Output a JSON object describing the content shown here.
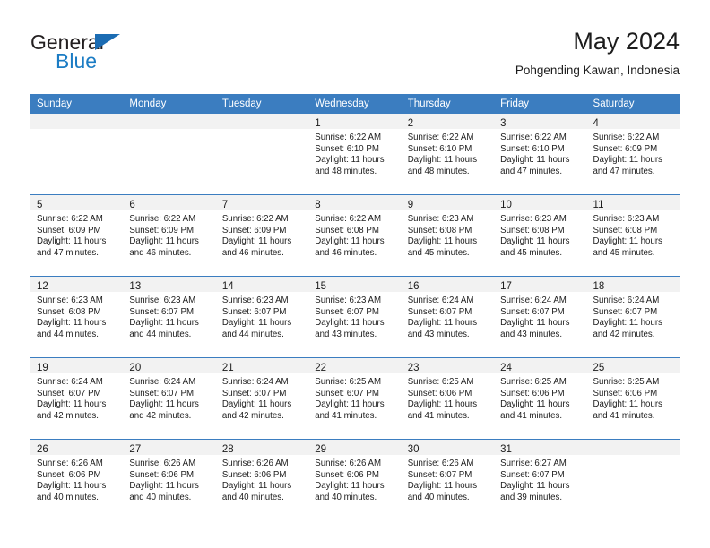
{
  "brand": {
    "name_part1": "General",
    "name_part2": "Blue",
    "triangle_icon": "triangle-icon",
    "accent_color": "#1b7cc4"
  },
  "header": {
    "title": "May 2024",
    "location": "Pohgending Kawan, Indonesia"
  },
  "theme": {
    "header_blue": "#3b7dc0",
    "daynum_strip": "#f2f2f2",
    "text": "#1c1c1c"
  },
  "weekdays": [
    "Sunday",
    "Monday",
    "Tuesday",
    "Wednesday",
    "Thursday",
    "Friday",
    "Saturday"
  ],
  "weeks": [
    [
      {
        "day": "",
        "lines": []
      },
      {
        "day": "",
        "lines": []
      },
      {
        "day": "",
        "lines": []
      },
      {
        "day": "1",
        "lines": [
          "Sunrise: 6:22 AM",
          "Sunset: 6:10 PM",
          "Daylight: 11 hours",
          "and 48 minutes."
        ]
      },
      {
        "day": "2",
        "lines": [
          "Sunrise: 6:22 AM",
          "Sunset: 6:10 PM",
          "Daylight: 11 hours",
          "and 48 minutes."
        ]
      },
      {
        "day": "3",
        "lines": [
          "Sunrise: 6:22 AM",
          "Sunset: 6:10 PM",
          "Daylight: 11 hours",
          "and 47 minutes."
        ]
      },
      {
        "day": "4",
        "lines": [
          "Sunrise: 6:22 AM",
          "Sunset: 6:09 PM",
          "Daylight: 11 hours",
          "and 47 minutes."
        ]
      }
    ],
    [
      {
        "day": "5",
        "lines": [
          "Sunrise: 6:22 AM",
          "Sunset: 6:09 PM",
          "Daylight: 11 hours",
          "and 47 minutes."
        ]
      },
      {
        "day": "6",
        "lines": [
          "Sunrise: 6:22 AM",
          "Sunset: 6:09 PM",
          "Daylight: 11 hours",
          "and 46 minutes."
        ]
      },
      {
        "day": "7",
        "lines": [
          "Sunrise: 6:22 AM",
          "Sunset: 6:09 PM",
          "Daylight: 11 hours",
          "and 46 minutes."
        ]
      },
      {
        "day": "8",
        "lines": [
          "Sunrise: 6:22 AM",
          "Sunset: 6:08 PM",
          "Daylight: 11 hours",
          "and 46 minutes."
        ]
      },
      {
        "day": "9",
        "lines": [
          "Sunrise: 6:23 AM",
          "Sunset: 6:08 PM",
          "Daylight: 11 hours",
          "and 45 minutes."
        ]
      },
      {
        "day": "10",
        "lines": [
          "Sunrise: 6:23 AM",
          "Sunset: 6:08 PM",
          "Daylight: 11 hours",
          "and 45 minutes."
        ]
      },
      {
        "day": "11",
        "lines": [
          "Sunrise: 6:23 AM",
          "Sunset: 6:08 PM",
          "Daylight: 11 hours",
          "and 45 minutes."
        ]
      }
    ],
    [
      {
        "day": "12",
        "lines": [
          "Sunrise: 6:23 AM",
          "Sunset: 6:08 PM",
          "Daylight: 11 hours",
          "and 44 minutes."
        ]
      },
      {
        "day": "13",
        "lines": [
          "Sunrise: 6:23 AM",
          "Sunset: 6:07 PM",
          "Daylight: 11 hours",
          "and 44 minutes."
        ]
      },
      {
        "day": "14",
        "lines": [
          "Sunrise: 6:23 AM",
          "Sunset: 6:07 PM",
          "Daylight: 11 hours",
          "and 44 minutes."
        ]
      },
      {
        "day": "15",
        "lines": [
          "Sunrise: 6:23 AM",
          "Sunset: 6:07 PM",
          "Daylight: 11 hours",
          "and 43 minutes."
        ]
      },
      {
        "day": "16",
        "lines": [
          "Sunrise: 6:24 AM",
          "Sunset: 6:07 PM",
          "Daylight: 11 hours",
          "and 43 minutes."
        ]
      },
      {
        "day": "17",
        "lines": [
          "Sunrise: 6:24 AM",
          "Sunset: 6:07 PM",
          "Daylight: 11 hours",
          "and 43 minutes."
        ]
      },
      {
        "day": "18",
        "lines": [
          "Sunrise: 6:24 AM",
          "Sunset: 6:07 PM",
          "Daylight: 11 hours",
          "and 42 minutes."
        ]
      }
    ],
    [
      {
        "day": "19",
        "lines": [
          "Sunrise: 6:24 AM",
          "Sunset: 6:07 PM",
          "Daylight: 11 hours",
          "and 42 minutes."
        ]
      },
      {
        "day": "20",
        "lines": [
          "Sunrise: 6:24 AM",
          "Sunset: 6:07 PM",
          "Daylight: 11 hours",
          "and 42 minutes."
        ]
      },
      {
        "day": "21",
        "lines": [
          "Sunrise: 6:24 AM",
          "Sunset: 6:07 PM",
          "Daylight: 11 hours",
          "and 42 minutes."
        ]
      },
      {
        "day": "22",
        "lines": [
          "Sunrise: 6:25 AM",
          "Sunset: 6:07 PM",
          "Daylight: 11 hours",
          "and 41 minutes."
        ]
      },
      {
        "day": "23",
        "lines": [
          "Sunrise: 6:25 AM",
          "Sunset: 6:06 PM",
          "Daylight: 11 hours",
          "and 41 minutes."
        ]
      },
      {
        "day": "24",
        "lines": [
          "Sunrise: 6:25 AM",
          "Sunset: 6:06 PM",
          "Daylight: 11 hours",
          "and 41 minutes."
        ]
      },
      {
        "day": "25",
        "lines": [
          "Sunrise: 6:25 AM",
          "Sunset: 6:06 PM",
          "Daylight: 11 hours",
          "and 41 minutes."
        ]
      }
    ],
    [
      {
        "day": "26",
        "lines": [
          "Sunrise: 6:26 AM",
          "Sunset: 6:06 PM",
          "Daylight: 11 hours",
          "and 40 minutes."
        ]
      },
      {
        "day": "27",
        "lines": [
          "Sunrise: 6:26 AM",
          "Sunset: 6:06 PM",
          "Daylight: 11 hours",
          "and 40 minutes."
        ]
      },
      {
        "day": "28",
        "lines": [
          "Sunrise: 6:26 AM",
          "Sunset: 6:06 PM",
          "Daylight: 11 hours",
          "and 40 minutes."
        ]
      },
      {
        "day": "29",
        "lines": [
          "Sunrise: 6:26 AM",
          "Sunset: 6:06 PM",
          "Daylight: 11 hours",
          "and 40 minutes."
        ]
      },
      {
        "day": "30",
        "lines": [
          "Sunrise: 6:26 AM",
          "Sunset: 6:07 PM",
          "Daylight: 11 hours",
          "and 40 minutes."
        ]
      },
      {
        "day": "31",
        "lines": [
          "Sunrise: 6:27 AM",
          "Sunset: 6:07 PM",
          "Daylight: 11 hours",
          "and 39 minutes."
        ]
      },
      {
        "day": "",
        "lines": []
      }
    ]
  ]
}
